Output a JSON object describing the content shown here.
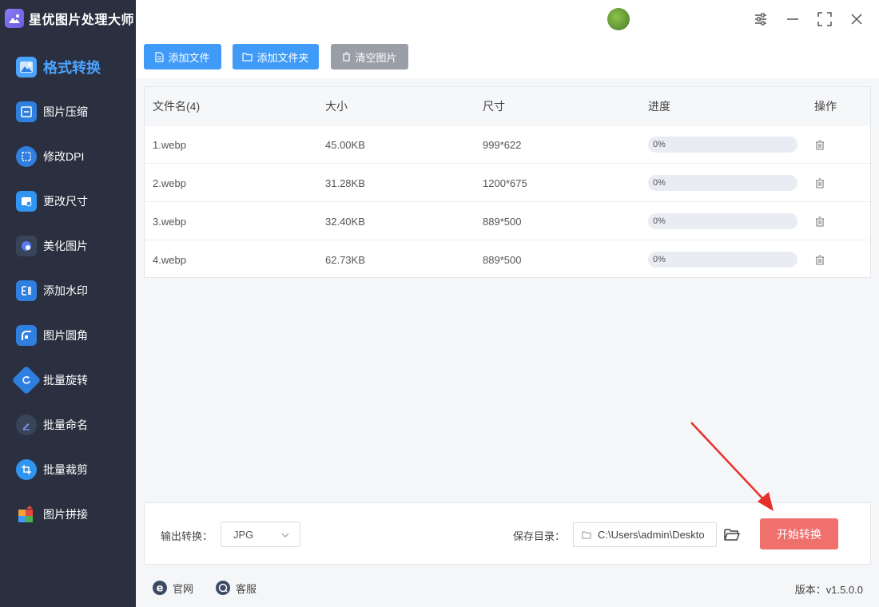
{
  "app": {
    "title": "星优图片处理大师"
  },
  "sidebar": {
    "items": [
      {
        "label": "格式转换",
        "icon": "format-convert-icon",
        "active": true
      },
      {
        "label": "图片压缩",
        "icon": "compress-icon"
      },
      {
        "label": "修改DPI",
        "icon": "dpi-icon"
      },
      {
        "label": "更改尺寸",
        "icon": "resize-icon"
      },
      {
        "label": "美化图片",
        "icon": "beautify-icon"
      },
      {
        "label": "添加水印",
        "icon": "watermark-icon"
      },
      {
        "label": "图片圆角",
        "icon": "round-corner-icon"
      },
      {
        "label": "批量旋转",
        "icon": "rotate-icon"
      },
      {
        "label": "批量命名",
        "icon": "rename-icon"
      },
      {
        "label": "批量裁剪",
        "icon": "crop-icon"
      },
      {
        "label": "图片拼接",
        "icon": "stitch-icon"
      }
    ]
  },
  "toolbar": {
    "add_file": "添加文件",
    "add_folder": "添加文件夹",
    "clear": "清空图片"
  },
  "table": {
    "headers": {
      "name": "文件名(4)",
      "size": "大小",
      "dims": "尺寸",
      "progress": "进度",
      "action": "操作"
    },
    "rows": [
      {
        "name": "1.webp",
        "size": "45.00KB",
        "dims": "999*622",
        "progress": "0%"
      },
      {
        "name": "2.webp",
        "size": "31.28KB",
        "dims": "1200*675",
        "progress": "0%"
      },
      {
        "name": "3.webp",
        "size": "32.40KB",
        "dims": "889*500",
        "progress": "0%"
      },
      {
        "name": "4.webp",
        "size": "62.73KB",
        "dims": "889*500",
        "progress": "0%"
      }
    ]
  },
  "bottom": {
    "output_label": "输出转换：",
    "output_format": "JPG",
    "save_label": "保存目录：",
    "save_path": "C:\\Users\\admin\\Deskto",
    "start_button": "开始转换"
  },
  "footer": {
    "website": "官网",
    "support": "客服",
    "version": "版本：v1.5.0.0"
  },
  "colors": {
    "sidebar": "#2b3040",
    "primary": "#3f9bf7",
    "start": "#f0706d",
    "arrow": "#e8302a"
  }
}
